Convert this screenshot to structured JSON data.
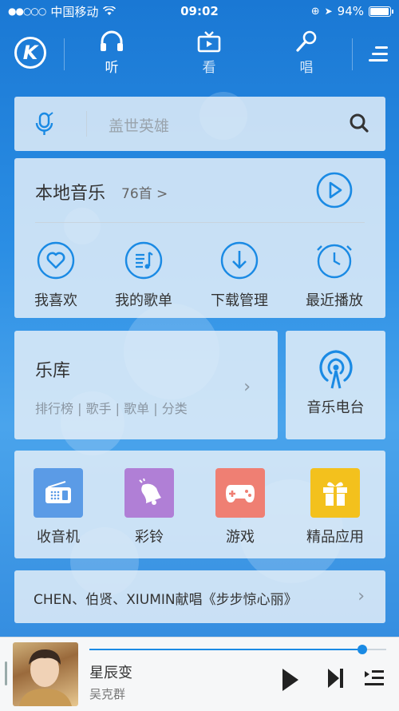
{
  "status_bar": {
    "carrier": "中国移动",
    "time": "09:02",
    "battery": "94%"
  },
  "nav": {
    "tabs": [
      {
        "label": "听",
        "icon": "headphones-icon",
        "active": true
      },
      {
        "label": "看",
        "icon": "tv-icon",
        "active": false
      },
      {
        "label": "唱",
        "icon": "microphone-icon",
        "active": false
      }
    ]
  },
  "search": {
    "placeholder": "盖世英雄"
  },
  "local_music": {
    "title": "本地音乐",
    "count": "76首 >",
    "shortcuts": [
      {
        "label": "我喜欢",
        "icon": "heart-icon"
      },
      {
        "label": "我的歌单",
        "icon": "playlist-icon"
      },
      {
        "label": "下载管理",
        "icon": "download-icon"
      },
      {
        "label": "最近播放",
        "icon": "clock-icon"
      }
    ]
  },
  "library": {
    "title": "乐库",
    "subtitle": "排行榜 | 歌手 | 歌单 | 分类",
    "radio_label": "音乐电台"
  },
  "apps": [
    {
      "label": "收音机",
      "icon": "radio-icon",
      "color": "#5b9be6"
    },
    {
      "label": "彩铃",
      "icon": "bell-icon",
      "color": "#b07fd6"
    },
    {
      "label": "游戏",
      "icon": "gamepad-icon",
      "color": "#ef7f73"
    },
    {
      "label": "精品应用",
      "icon": "gift-icon",
      "color": "#f3c11d"
    }
  ],
  "promo": {
    "text": "CHEN、伯贤、XIUMIN献唱《步步惊心丽》"
  },
  "player": {
    "song_title": "星辰变",
    "artist": "吴克群",
    "progress": 0.92
  },
  "colors": {
    "accent": "#1a8ae4",
    "nav_bg": "#1a78d4"
  }
}
